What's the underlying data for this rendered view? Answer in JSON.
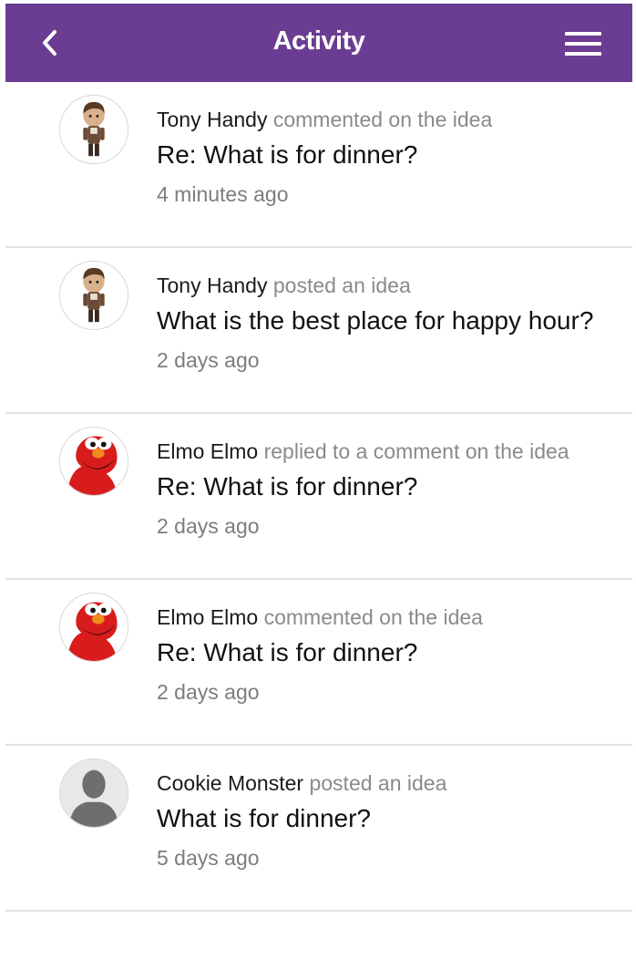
{
  "header": {
    "title": "Activity",
    "back_icon": "chevron-left-icon",
    "menu_icon": "hamburger-menu-icon",
    "background_color": "#6b3d92"
  },
  "feed": [
    {
      "actor": "Tony Handy",
      "action": "commented on the idea",
      "subject": "Re: What is for dinner?",
      "time": "4 minutes ago",
      "avatar": "tony-avatar"
    },
    {
      "actor": "Tony Handy",
      "action": "posted an idea",
      "subject": "What is the best place for happy hour?",
      "time": "2 days ago",
      "avatar": "tony-avatar"
    },
    {
      "actor": "Elmo Elmo",
      "action": "replied to a comment on the idea",
      "subject": "Re: What is for dinner?",
      "time": "2 days ago",
      "avatar": "elmo-avatar"
    },
    {
      "actor": "Elmo Elmo",
      "action": "commented on the idea",
      "subject": "Re: What is for dinner?",
      "time": "2 days ago",
      "avatar": "elmo-avatar"
    },
    {
      "actor": "Cookie Monster",
      "action": "posted an idea",
      "subject": "What is for dinner?",
      "time": "5 days ago",
      "avatar": "default-person-avatar"
    }
  ]
}
